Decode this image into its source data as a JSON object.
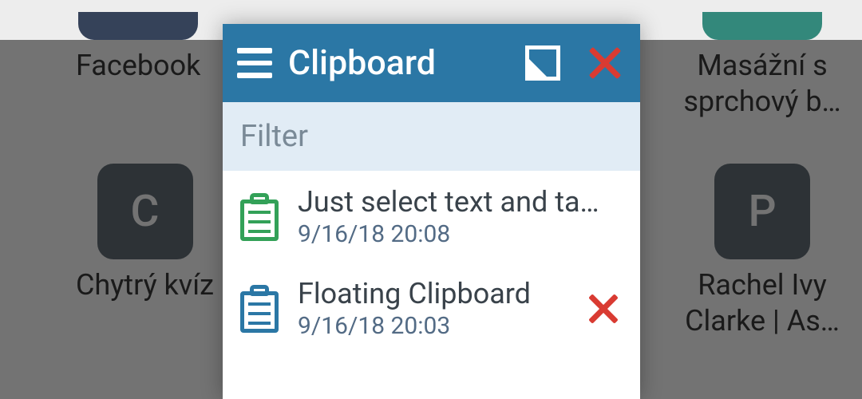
{
  "background": {
    "apps": [
      {
        "label": "Facebook"
      },
      {
        "label": "Masážní s sprchový b…"
      },
      {
        "label": "Chytrý kvíz",
        "letter": "C"
      },
      {
        "label": "Rachel Ivy Clarke | As…",
        "letter": "P"
      }
    ]
  },
  "popup": {
    "title": "Clipboard",
    "filter_placeholder": "Filter",
    "items": [
      {
        "text": "Just select text and ta…",
        "time": "9/16/18 20:08",
        "icon": "clipboard-green",
        "deletable": false
      },
      {
        "text": "Floating Clipboard",
        "time": "9/16/18 20:03",
        "icon": "clipboard-blue",
        "deletable": true
      }
    ]
  }
}
